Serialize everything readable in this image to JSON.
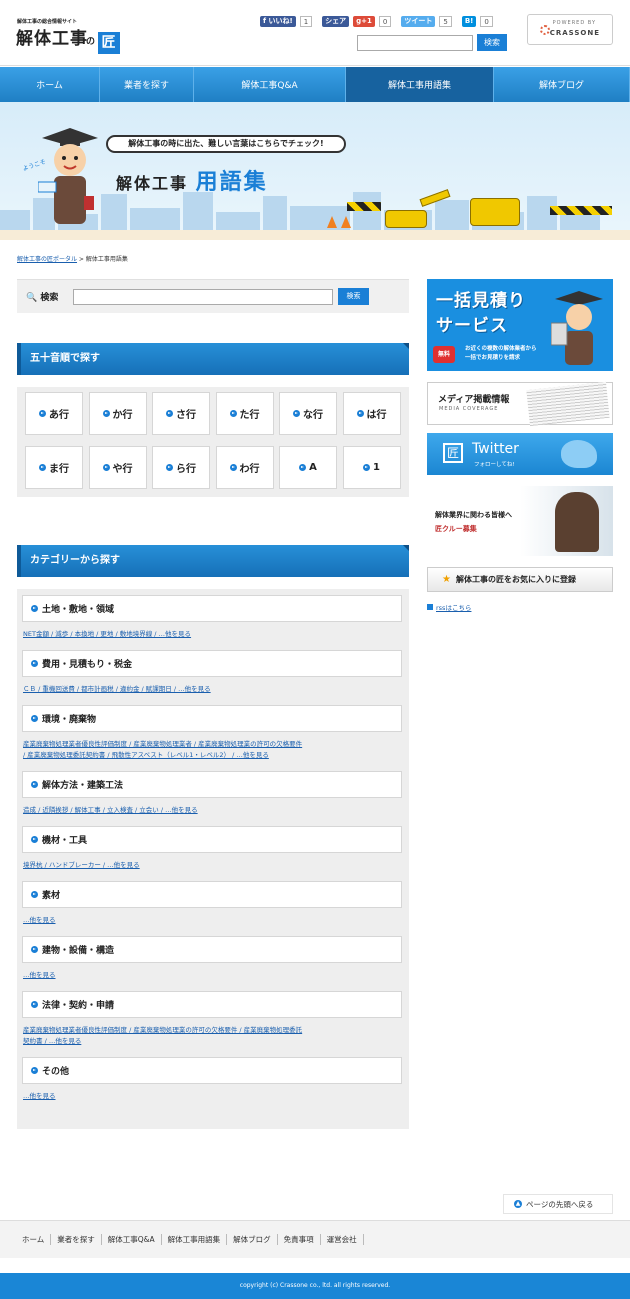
{
  "header": {
    "tagline": "解体工事の総合情報サイト",
    "logo_text": "解体工事",
    "logo_no": "の",
    "logo_mark": "匠",
    "social": [
      {
        "label": "f いいね!",
        "count": "1",
        "color": "#3b5998"
      },
      {
        "label": "シェア",
        "count": "",
        "color": "#3b5998"
      },
      {
        "label": "g+1",
        "count": "0",
        "color": "#dd4b39"
      },
      {
        "label": "ツイート",
        "count": "5",
        "color": "#55acee"
      },
      {
        "label": "B!",
        "count": "0",
        "color": "#008fde"
      }
    ],
    "search_button": "検索",
    "powered_by": "POWERED BY",
    "powered_name": "CRASSONE"
  },
  "nav": [
    {
      "label": "ホーム",
      "active": false
    },
    {
      "label": "業者を探す",
      "active": false
    },
    {
      "label": "解体工事Q&A",
      "active": false
    },
    {
      "label": "解体工事用語集",
      "active": true
    },
    {
      "label": "解体ブログ",
      "active": false
    }
  ],
  "banner": {
    "bubble": "解体工事の時に出た、難しい言葉はこちらでチェック!",
    "title_a": "解体工事",
    "title_b": "用語集",
    "tag": "ようこそ"
  },
  "breadcrumb": {
    "home": "解体工事の匠ポータル",
    "sep": " > ",
    "current": "解体工事用語集"
  },
  "search": {
    "label": "検索",
    "button": "検索"
  },
  "gojuon": {
    "heading": "五十音順で探す",
    "items": [
      "あ行",
      "か行",
      "さ行",
      "た行",
      "な行",
      "は行",
      "ま行",
      "や行",
      "ら行",
      "わ行",
      "A",
      "1"
    ]
  },
  "categories": {
    "heading": "カテゴリーから探す",
    "items": [
      {
        "name": "土地・敷地・領域",
        "lines": [
          "NET金額 / 減歩 / 本換地 / 更地 / 敷地境界線 / …他を見る"
        ]
      },
      {
        "name": "費用・見積もり・税金",
        "lines": [
          "ＣＢ / 重機回送費 / 都市計画税 / 違約金 / 賦課期日 / …他を見る"
        ]
      },
      {
        "name": "環境・廃棄物",
        "lines": [
          "産業廃棄物処理業者優良性評価制度 / 産業廃棄物処理業者 / 産業廃棄物処理業の許可の欠格要件",
          "/ 産業廃棄物処理委託契約書 / 飛散性アスベスト（レベル1・レベル2） / …他を見る"
        ]
      },
      {
        "name": "解体方法・建築工法",
        "lines": [
          "造成 / 近隣挨拶 / 解体工事 / 立入検査 / 立会い / …他を見る"
        ]
      },
      {
        "name": "機材・工具",
        "lines": [
          "境界杭 / ハンドブレーカー / …他を見る"
        ]
      },
      {
        "name": "素材",
        "lines": [
          "…他を見る"
        ]
      },
      {
        "name": "建物・設備・構造",
        "lines": [
          "…他を見る"
        ]
      },
      {
        "name": "法律・契約・申請",
        "lines": [
          "産業廃棄物処理業者優良性評価制度 / 産業廃棄物処理業の許可の欠格要件 / 産業廃棄物処理委託",
          "契約書 / …他を見る"
        ]
      },
      {
        "name": "その他",
        "lines": [
          "…他を見る"
        ]
      }
    ]
  },
  "sidebar": {
    "estimate_t1": "一括見積り",
    "estimate_t2": "サービス",
    "estimate_free": "無料",
    "estimate_desc1": "お近くの複数の解体業者から",
    "estimate_desc2": "一括でお見積りを請求",
    "media_title": "メディア掲載情報",
    "media_sub": "MEDIA COVERAGE",
    "twitter_mark": "匠",
    "twitter_title": "Twitter",
    "twitter_follow": "フォローしてね!",
    "recruit_line": "解体業界に関わる皆様へ",
    "recruit_sub": "匠クルー募集",
    "favorite": "解体工事の匠をお気に入りに登録",
    "rss": "rssはこちら"
  },
  "pagetop": "ページの先頭へ戻る",
  "footer": {
    "links": [
      "ホーム",
      "業者を探す",
      "解体工事Q&A",
      "解体工事用語集",
      "解体ブログ",
      "免責事項",
      "運営会社"
    ],
    "copyright": "copyright (c) Crassone co., ltd. all rights reserved."
  }
}
